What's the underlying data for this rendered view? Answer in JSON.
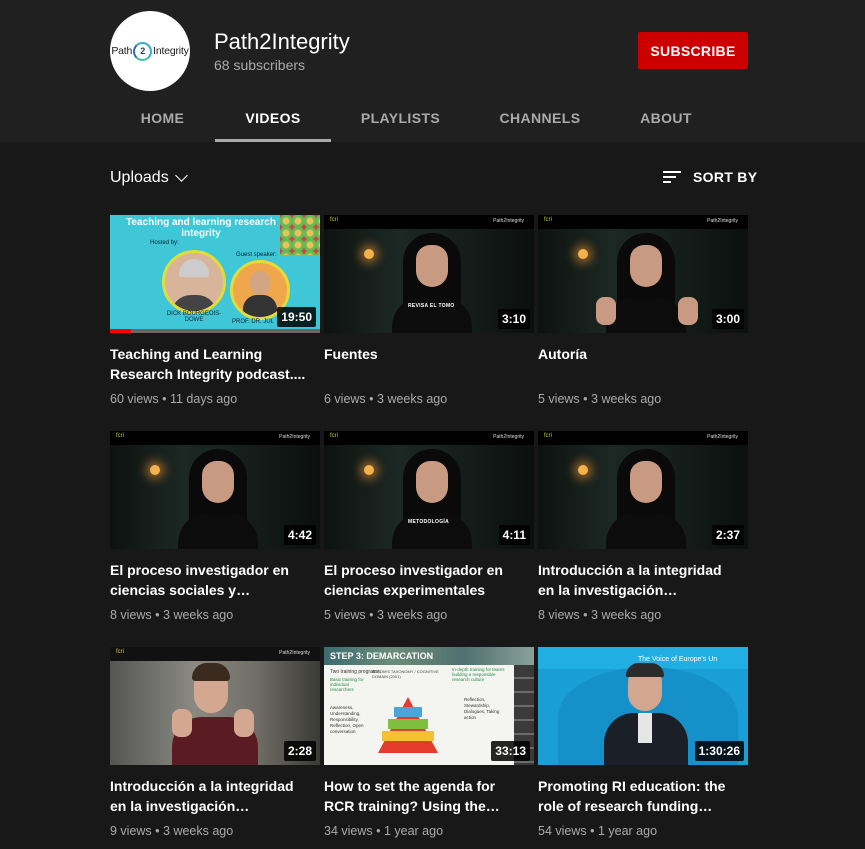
{
  "channel": {
    "avatar_left": "Path",
    "avatar_mid": "2",
    "avatar_right": "Integrity",
    "name": "Path2Integrity",
    "subscribers": "68 subscribers",
    "subscribe_label": "SUBSCRIBE"
  },
  "tabs": [
    {
      "label": "HOME",
      "active": false
    },
    {
      "label": "VIDEOS",
      "active": true
    },
    {
      "label": "PLAYLISTS",
      "active": false
    },
    {
      "label": "CHANNELS",
      "active": false
    },
    {
      "label": "ABOUT",
      "active": false
    }
  ],
  "toolbar": {
    "uploads_label": "Uploads",
    "sort_label": "SORT BY"
  },
  "videos": [
    {
      "title": "Teaching and Learning Research Integrity podcast....",
      "views": "60 views",
      "age": "11 days ago",
      "duration": "19:50",
      "thumb_text": {
        "heading": "Teaching and learning research integrity",
        "hosted": "Hosted by:",
        "guest": "Guest speaker:",
        "host_name": "DICK BOURGEOIS-DOWE",
        "guest_name": "PROF. DR. JUL"
      },
      "watched_fraction": 0.1
    },
    {
      "title": "Fuentes",
      "views": "6 views",
      "age": "3 weeks ago",
      "duration": "3:10",
      "caption": "REVISA EL TOMO",
      "tag_left": "fcri",
      "tag_right": "Path2Integrity"
    },
    {
      "title": "Autoría",
      "views": "5 views",
      "age": "3 weeks ago",
      "duration": "3:00",
      "tag_left": "fcri",
      "tag_right": "Path2Integrity"
    },
    {
      "title": "El proceso investigador en ciencias sociales y…",
      "views": "8 views",
      "age": "3 weeks ago",
      "duration": "4:42",
      "tag_left": "fcri",
      "tag_right": "Path2Integrity"
    },
    {
      "title": "El proceso investigador en ciencias experimentales",
      "views": "5 views",
      "age": "3 weeks ago",
      "duration": "4:11",
      "caption": "METODOLOGÍA",
      "tag_left": "fcri",
      "tag_right": "Path2Integrity"
    },
    {
      "title": "Introducción a la integridad en la investigación…",
      "views": "8 views",
      "age": "3 weeks ago",
      "duration": "2:37",
      "tag_left": "fcri",
      "tag_right": "Path2Integrity"
    },
    {
      "title": "Introducción a la integridad en la investigación…",
      "views": "9 views",
      "age": "3 weeks ago",
      "duration": "2:28",
      "tag_left": "fcri",
      "tag_right": "Path2Integrity"
    },
    {
      "title": "How to set the agenda for RCR training? Using the…",
      "views": "34 views",
      "age": "1 year ago",
      "duration": "33:13",
      "thumb_text": {
        "step": "STEP 3: DEMARCATION",
        "two": "Two training programs:",
        "basic": "Basic training for individual researchers",
        "indepth": "In-depth training for teams building a responsible research culture",
        "bloom": "BLOOM'S TAXONOMY / COGNITIVE DOMAIN (2001)",
        "left_list": "Awareness, Understanding, Responsibility, Reflection, Open conversation",
        "right_list": "Reflection, Stewardship, Dialogues, Taking action"
      }
    },
    {
      "title": "Promoting RI education: the role of research funding…",
      "views": "54 views",
      "age": "1 year ago",
      "duration": "1:30:26",
      "thumb_text": {
        "banner": "The Voice of Europe's Un"
      }
    }
  ],
  "colors": {
    "background": "#181818",
    "header": "#202020",
    "subscribe": "#cc0000",
    "muted_text": "#aaaaaa",
    "progress": "#ff0000"
  }
}
